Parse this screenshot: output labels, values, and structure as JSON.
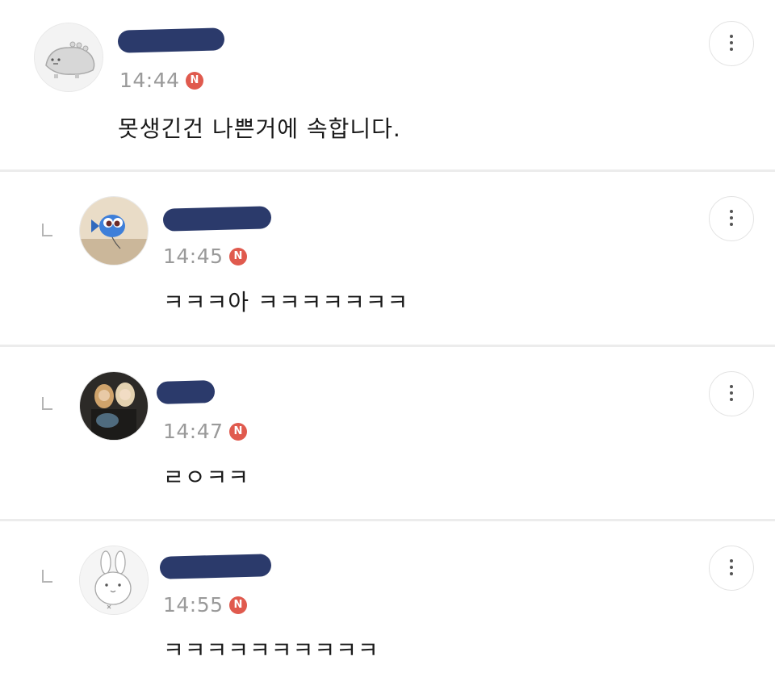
{
  "comments": [
    {
      "time": "14:44",
      "badge": "N",
      "text": "못생긴건 나쁜거에 속합니다.",
      "avatar_icon": "cartoon-creature-icon",
      "is_reply": false
    },
    {
      "time": "14:45",
      "badge": "N",
      "text": "ㅋㅋㅋ아 ㅋㅋㅋㅋㅋㅋㅋ",
      "avatar_icon": "blue-fish-icon",
      "is_reply": true
    },
    {
      "time": "14:47",
      "badge": "N",
      "text": "ㄹㅇㅋㅋ",
      "avatar_icon": "photo-avatar",
      "is_reply": true
    },
    {
      "time": "14:55",
      "badge": "N",
      "text": "ㅋㅋㅋㅋㅋㅋㅋㅋㅋㅋ",
      "avatar_icon": "bunny-icon",
      "is_reply": true
    }
  ],
  "colors": {
    "badge": "#e05a4e",
    "redaction": "#2b3a6b",
    "divider": "#ececec",
    "time": "#9a9a9a"
  },
  "more_button_icon": "more-vertical-icon",
  "reply_indicator_icon": "reply-arrow-icon"
}
